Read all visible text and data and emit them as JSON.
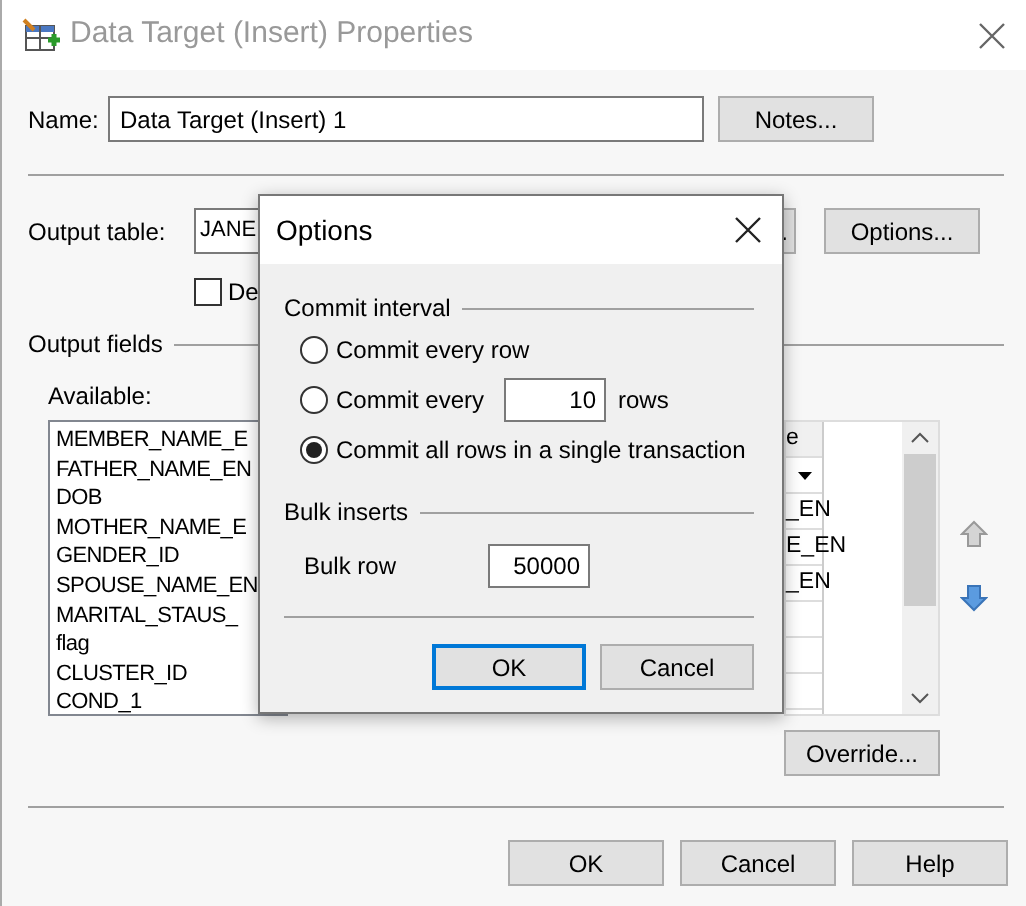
{
  "window": {
    "title": "Data Target (Insert) Properties"
  },
  "name": {
    "label": "Name:",
    "value": "Data Target (Insert) 1"
  },
  "notes_button": "Notes...",
  "output_table": {
    "label": "Output table:",
    "value": "JANE",
    "browse_button": ".",
    "options_button": "Options..."
  },
  "checkbox": {
    "label": "De",
    "checked": false
  },
  "output_fields": {
    "title": "Output fields",
    "available_label": "Available:",
    "available": [
      "MEMBER_NAME_E",
      "FATHER_NAME_EN",
      "DOB",
      "MOTHER_NAME_E",
      "GENDER_ID",
      "SPOUSE_NAME_EN",
      "MARITAL_STAUS_",
      "flag",
      "CLUSTER_ID",
      "COND_1"
    ],
    "grid": {
      "header": "e",
      "rows": [
        "_EN",
        "E_EN",
        "_EN"
      ]
    },
    "override_button": "Override..."
  },
  "buttons": [
    "OK",
    "Cancel",
    "Help"
  ],
  "options_dialog": {
    "title": "Options",
    "commit_interval": {
      "title": "Commit interval",
      "options": [
        {
          "kind": "plain",
          "label": "Commit every row",
          "selected": false
        },
        {
          "kind": "count",
          "label": "Commit every",
          "selected": false,
          "value": "10",
          "suffix": "rows"
        },
        {
          "kind": "plain",
          "label": "Commit all rows in a single transaction",
          "selected": true
        }
      ]
    },
    "bulk_inserts": {
      "title": "Bulk inserts",
      "label": "Bulk row",
      "value": "50000"
    },
    "buttons": [
      {
        "label": "OK",
        "focused": true
      },
      {
        "label": "Cancel",
        "focused": false
      }
    ]
  }
}
